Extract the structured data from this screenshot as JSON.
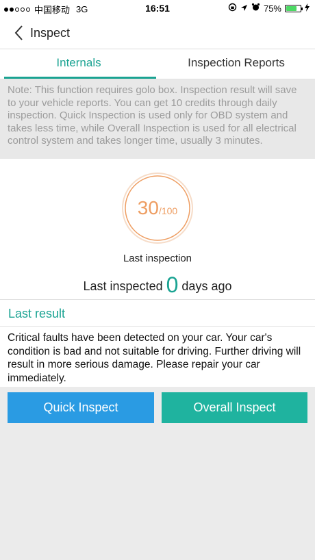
{
  "status_bar": {
    "carrier": "中国移动",
    "network": "3G",
    "time": "16:51",
    "battery_percent": "75%",
    "battery_level": 0.75
  },
  "nav": {
    "title": "Inspect",
    "back_icon": "chevron-left-icon"
  },
  "tabs": [
    {
      "label": "Internals",
      "active": true
    },
    {
      "label": "Inspection Reports",
      "active": false
    }
  ],
  "note": "Note: This function requires golo box. Inspection result will save to your vehicle reports. You can get 10 credits through daily inspection. Quick Inspection is used only for OBD system and takes less time, while Overall Inspection is used for all electrical control system and takes longer time, usually 3 minutes.",
  "score": {
    "value": "30",
    "max": "/100",
    "caption": "Last inspection"
  },
  "last_inspected": {
    "prefix": "Last inspected",
    "days": "0",
    "suffix": "days ago"
  },
  "last_result": {
    "heading": "Last result",
    "text": "Critical faults have been detected on your car. Your car's condition is bad and not suitable for driving. Further driving will result in more serious damage. Please repair your car immediately."
  },
  "buttons": {
    "quick": "Quick Inspect",
    "overall": "Overall Inspect"
  },
  "colors": {
    "accent": "#1aa392",
    "score": "#ee9e63",
    "quick_button": "#2a9be3",
    "overall_button": "#1fb39f"
  }
}
